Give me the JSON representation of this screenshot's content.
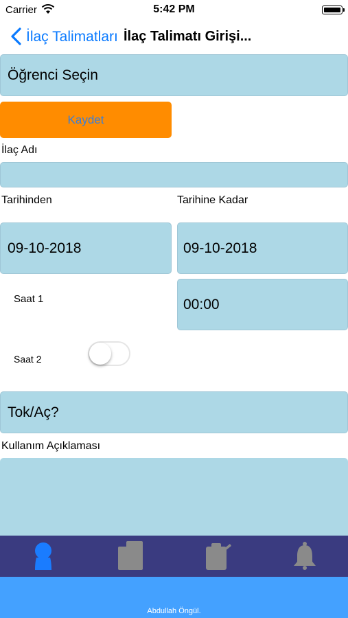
{
  "status_bar": {
    "carrier": "Carrier",
    "time": "5:42 PM"
  },
  "nav": {
    "back_label": "İlaç Talimatları",
    "title": "İlaç Talimatı Girişi..."
  },
  "student_select": {
    "label": "Öğrenci Seçin"
  },
  "save_button": {
    "label": "Kaydet"
  },
  "drug_name": {
    "label": "İlaç Adı",
    "value": ""
  },
  "date_from": {
    "label": "Tarihinden",
    "value": "09-10-2018"
  },
  "date_to": {
    "label": "Tarihine Kadar",
    "value": "09-10-2018"
  },
  "time1": {
    "label": "Saat 1",
    "value": "00:00"
  },
  "time2": {
    "label": "Saat 2",
    "enabled": false
  },
  "full_empty": {
    "label": "Tok/Aç?"
  },
  "usage_description": {
    "label": "Kullanım Açıklaması",
    "value": ""
  },
  "tab_bar": {
    "items": [
      {
        "icon": "person-icon",
        "selected": true
      },
      {
        "icon": "document-icon",
        "selected": false
      },
      {
        "icon": "clipboard-icon",
        "selected": false
      },
      {
        "icon": "bell-icon",
        "selected": false
      }
    ],
    "selected_color": "#1a7cff",
    "unselected_color": "#8a8a8a",
    "background": "#3a3b80"
  },
  "footer": {
    "text": "Abdullah Öngül."
  }
}
